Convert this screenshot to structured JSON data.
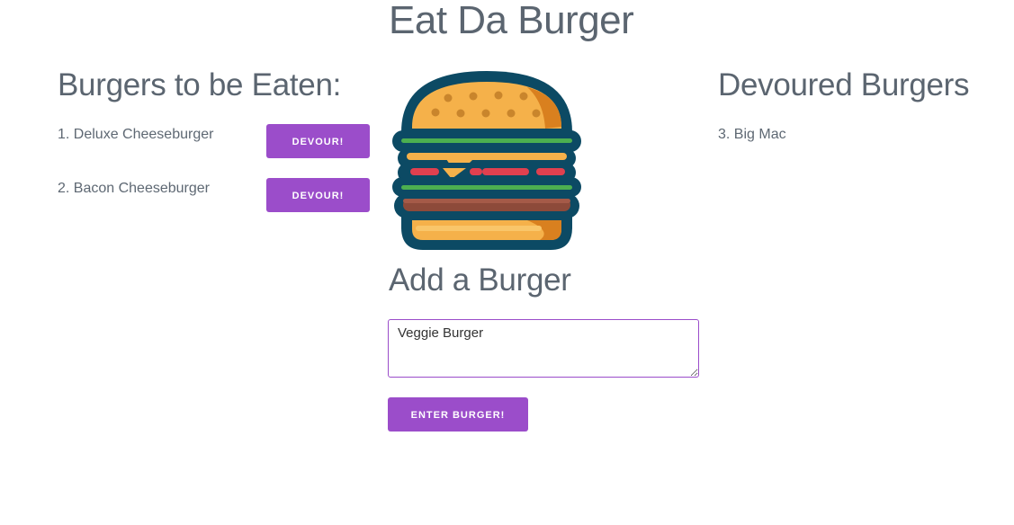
{
  "header": {
    "title": "Eat Da Burger"
  },
  "to_eat": {
    "heading": "Burgers to be Eaten:",
    "items": [
      {
        "label": "1. Deluxe Cheeseburger",
        "button": "DEVOUR!"
      },
      {
        "label": "2. Bacon Cheeseburger",
        "button": "DEVOUR!"
      }
    ]
  },
  "devoured": {
    "heading": "Devoured Burgers",
    "items": [
      {
        "label": "3. Big Mac"
      }
    ]
  },
  "add_form": {
    "heading": "Add a Burger",
    "input_value": "Veggie Burger",
    "submit_label": "ENTER BURGER!"
  },
  "colors": {
    "accent": "#9b4dca",
    "heading_text": "#5b6570",
    "bun": "#f5b14a",
    "outline": "#0c4a64",
    "lettuce": "#4caf50",
    "tomato": "#e0404f",
    "patty": "#8d4a3a"
  },
  "icons": {
    "burger_image": "burger-illustration"
  }
}
